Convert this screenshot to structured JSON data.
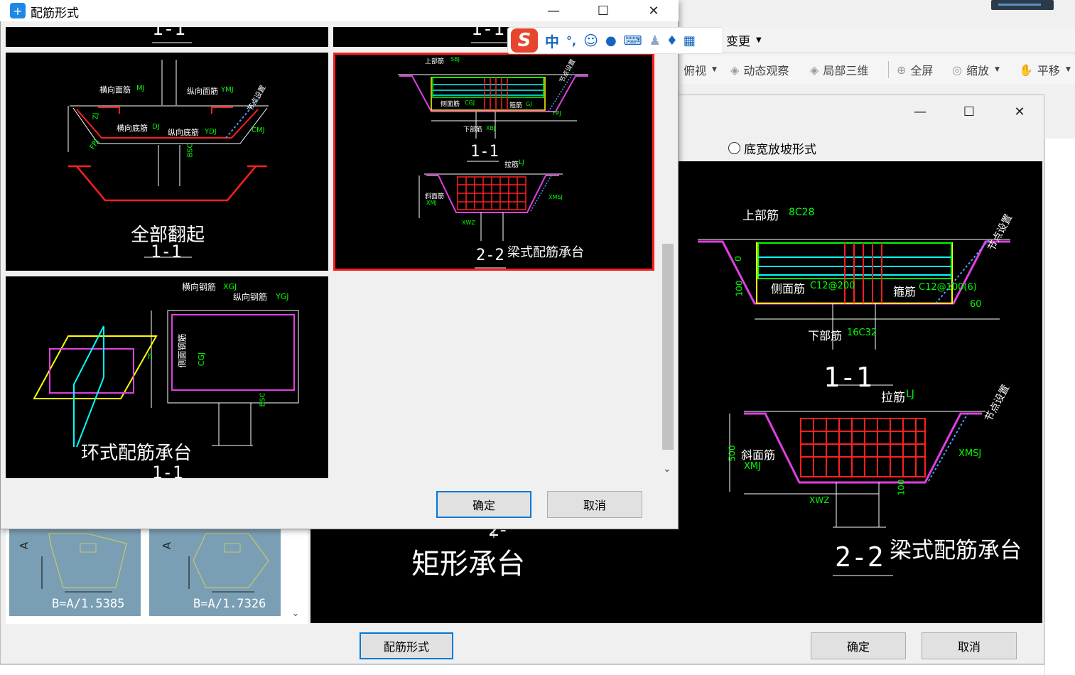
{
  "topbar": {
    "label": "变更"
  },
  "toolbar": {
    "items": [
      {
        "label": "俯视"
      },
      {
        "label": "动态观察"
      },
      {
        "label": "局部三维"
      },
      {
        "label": "全屏"
      },
      {
        "label": "缩放"
      },
      {
        "label": "平移"
      }
    ]
  },
  "ime": {
    "mode": "中",
    "punct": "°,"
  },
  "bg_dialog": {
    "radio_label": "底宽放坡形式",
    "rect_caption_top": "2-",
    "rect_caption": "矩形承台",
    "thumbs": [
      {
        "label": "B=A/1.5385",
        "side": "A"
      },
      {
        "label": "B=A/1.7326",
        "side": "A"
      }
    ],
    "rebar_btn": "配筋形式",
    "ok": "确定",
    "cancel": "取消",
    "preview": {
      "top_bar_label": "上部筋",
      "top_bar_val": "8C28",
      "side_label": "侧面筋",
      "side_val": "C12@200",
      "stirrup_label": "箍筋",
      "stirrup_val": "C12@100(6)",
      "angle": "60",
      "bottom_label": "下部筋",
      "bottom_val": "16C32",
      "sec11": "1-1",
      "tie_label": "拉筋",
      "tie_val": "LJ",
      "node_label": "节点设置",
      "slope_label": "斜面筋",
      "slope_code": "XMJ",
      "xmsj": "XMSJ",
      "xwz": "XWZ",
      "dim500": "500",
      "dim100": "100",
      "sec22": "2-2",
      "caption": "梁式配筋承台",
      "dim_a": "0",
      "dim_b": "100"
    }
  },
  "fg_dialog": {
    "title": "配筋形式",
    "ok": "确定",
    "cancel": "取消",
    "cells": [
      {
        "top": "1-1"
      },
      {
        "top": "1-1"
      },
      {
        "caption": "全部翻起",
        "sec": "1-1",
        "labels": [
          "横向面筋",
          "MJ",
          "纵向面筋",
          "YMJ",
          "横向底筋",
          "DJ",
          "纵向底筋",
          "YDJ",
          "CMJ",
          "FPJ",
          "节点设置",
          "ZJ",
          "BSC"
        ]
      },
      {
        "caption": "梁式配筋承台",
        "sec11": "1-1",
        "sec22": "2-2",
        "labels": [
          "上部筋",
          "SBJ",
          "侧面筋",
          "CGJ",
          "箍筋",
          "GJ",
          "下部筋",
          "XBJ",
          "拉筋",
          "LJ",
          "斜面筋",
          "XMJ",
          "XMSJ",
          "XWZ",
          "FPJ",
          "节点设置"
        ]
      },
      {
        "caption": "环式配筋承台",
        "sec": "1-1",
        "labels": [
          "横向钢筋",
          "XGJ",
          "纵向钢筋",
          "YGJ",
          "侧面钢筋",
          "CGJ",
          "h",
          "BSC"
        ]
      }
    ]
  }
}
